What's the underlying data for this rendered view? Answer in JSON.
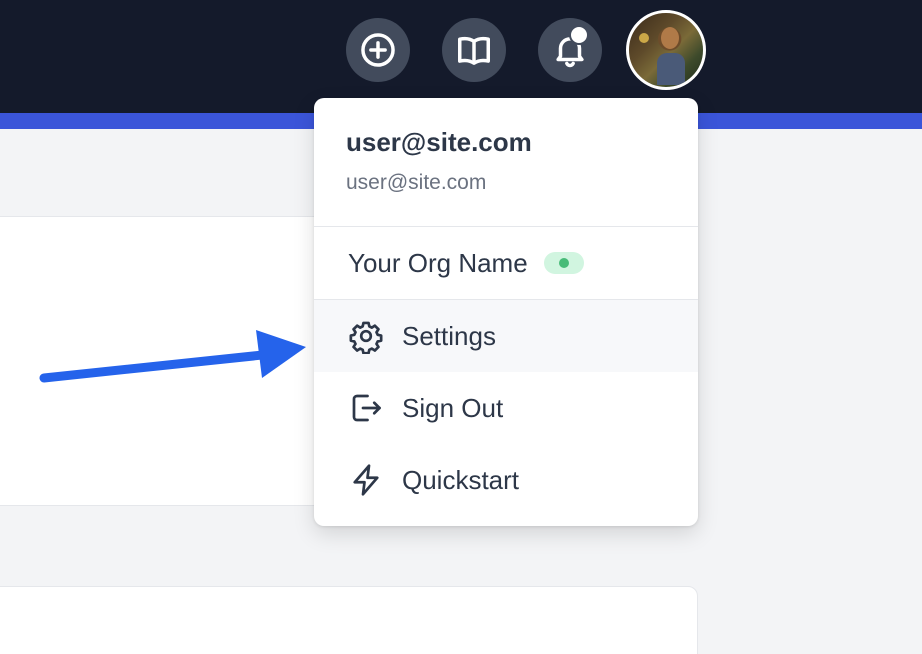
{
  "colors": {
    "topbar": "#141a2b",
    "accent_strip": "#3b55d9",
    "icon_button_bg": "#424b5c",
    "online_status": "#48bb78",
    "annotation_arrow": "#2563eb"
  },
  "topbar": {
    "buttons": [
      {
        "icon": "plus-circle-icon"
      },
      {
        "icon": "book-open-icon"
      },
      {
        "icon": "bell-icon",
        "has_notification": true
      }
    ],
    "avatar": {
      "icon": "user-avatar"
    }
  },
  "dropdown": {
    "user": {
      "name": "user@site.com",
      "email": "user@site.com"
    },
    "org": {
      "name": "Your Org Name",
      "status": "online"
    },
    "items": [
      {
        "icon": "gear-icon",
        "label": "Settings",
        "highlighted": true
      },
      {
        "icon": "sign-out-icon",
        "label": "Sign Out"
      },
      {
        "icon": "lightning-bolt-icon",
        "label": "Quickstart"
      }
    ]
  },
  "annotation": {
    "icon": "arrow-pointer",
    "target": "Settings"
  }
}
